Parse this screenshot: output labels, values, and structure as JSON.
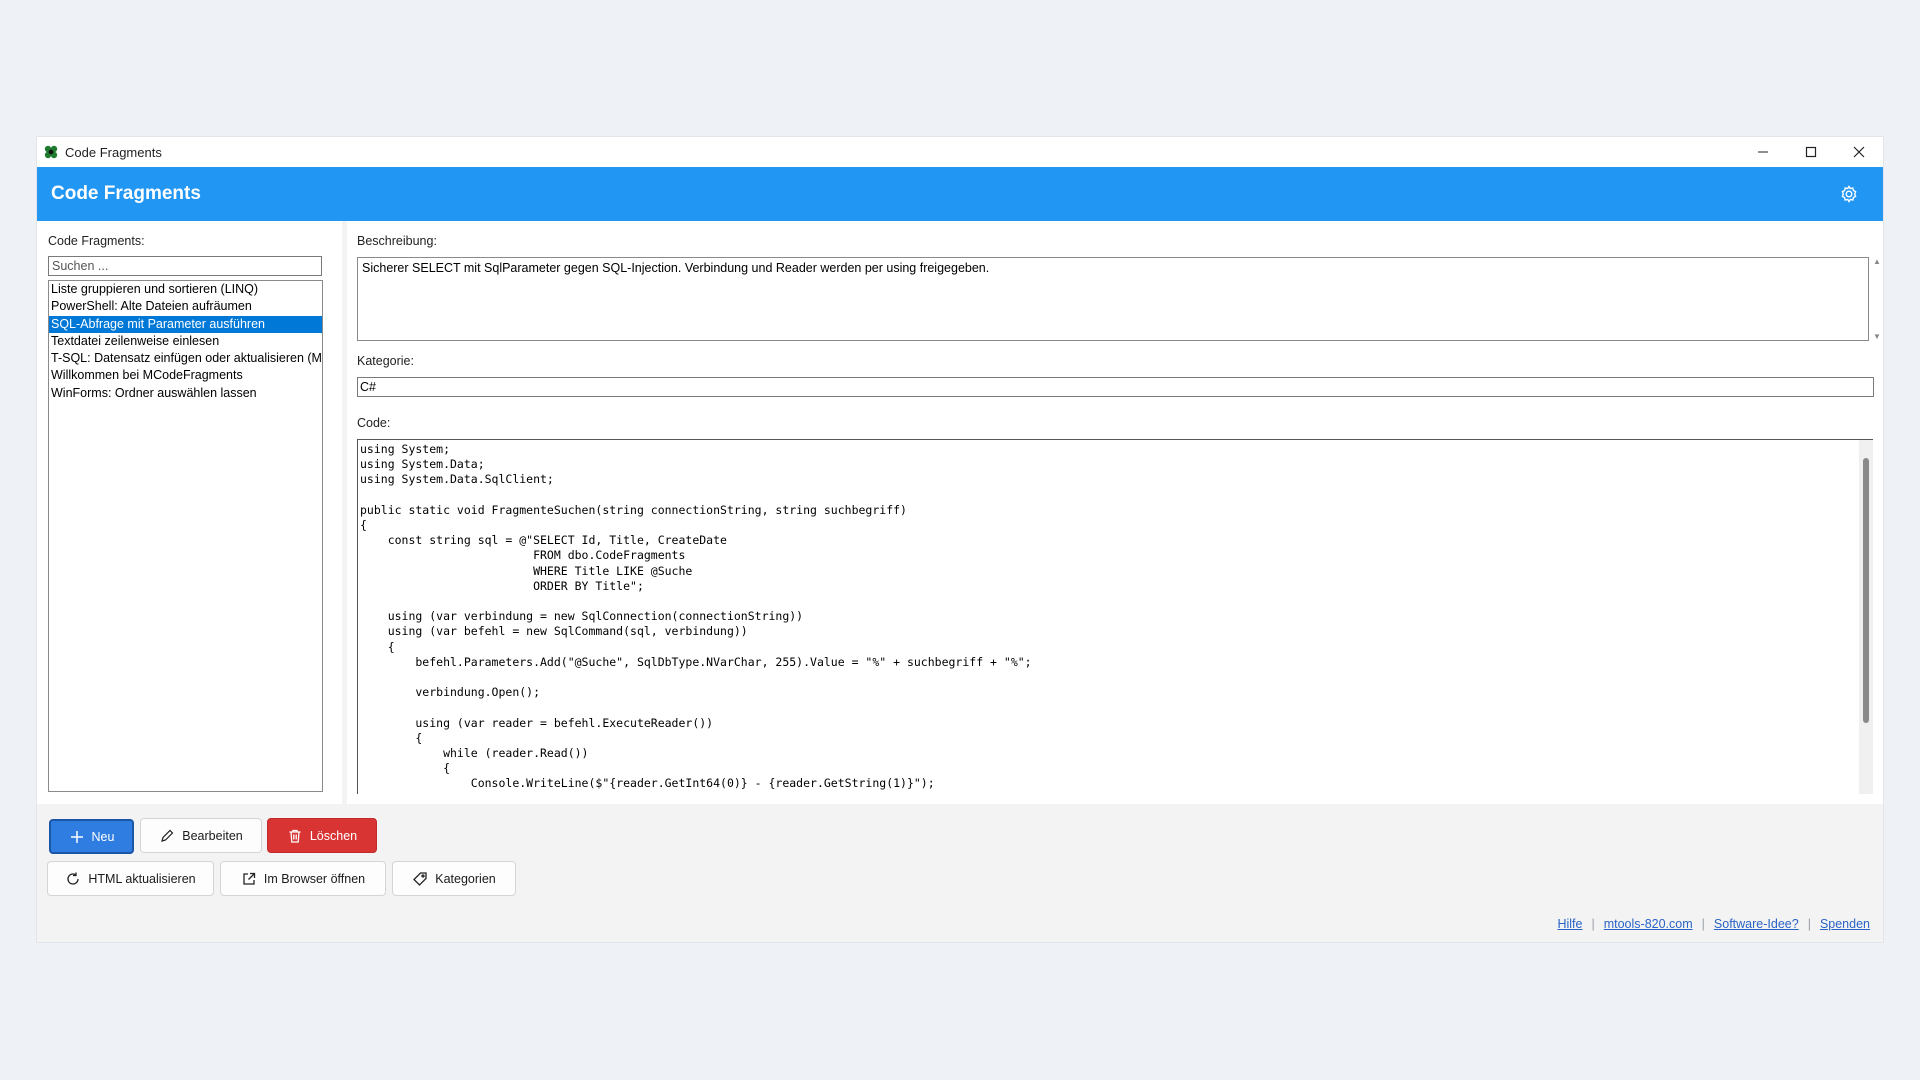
{
  "window": {
    "title": "Code Fragments",
    "controls": [
      "minimize-icon",
      "maximize-icon",
      "close-icon"
    ]
  },
  "header": {
    "title": "Code Fragments",
    "settings_icon": "gear-icon",
    "color": "#2196f3"
  },
  "sidebar": {
    "label": "Code Fragments:",
    "search_placeholder": "Suchen ...",
    "items": [
      "Liste gruppieren und sortieren (LINQ)",
      "PowerShell: Alte Dateien aufräumen",
      "SQL-Abfrage mit Parameter ausführen",
      "Textdatei zeilenweise einlesen",
      "T-SQL: Datensatz einfügen oder aktualisieren (MERGE)",
      "Willkommen bei MCodeFragments",
      "WinForms: Ordner auswählen lassen"
    ],
    "selected_index": 2
  },
  "detail": {
    "description_label": "Beschreibung:",
    "description": "Sicherer SELECT mit SqlParameter gegen SQL-Injection. Verbindung und Reader werden per using freigegeben.",
    "category_label": "Kategorie:",
    "category": "C#",
    "code_label": "Code:",
    "code": "using System;\nusing System.Data;\nusing System.Data.SqlClient;\n\npublic static void FragmenteSuchen(string connectionString, string suchbegriff)\n{\n    const string sql = @\"SELECT Id, Title, CreateDate\n                         FROM dbo.CodeFragments\n                         WHERE Title LIKE @Suche\n                         ORDER BY Title\";\n\n    using (var verbindung = new SqlConnection(connectionString))\n    using (var befehl = new SqlCommand(sql, verbindung))\n    {\n        befehl.Parameters.Add(\"@Suche\", SqlDbType.NVarChar, 255).Value = \"%\" + suchbegriff + \"%\";\n\n        verbindung.Open();\n\n        using (var reader = befehl.ExecuteReader())\n        {\n            while (reader.Read())\n            {\n                Console.WriteLine($\"{reader.GetInt64(0)} - {reader.GetString(1)}\");"
  },
  "toolbar": {
    "new_label": "Neu",
    "edit_label": "Bearbeiten",
    "delete_label": "Löschen",
    "refresh_html_label": "HTML aktualisieren",
    "open_browser_label": "Im Browser öffnen",
    "categories_label": "Kategorien",
    "icons": [
      "plus-icon",
      "pencil-icon",
      "trash-icon",
      "refresh-icon",
      "external-link-icon",
      "tag-icon"
    ]
  },
  "footer": {
    "links": [
      "Hilfe",
      "mtools-820.com",
      "Software-Idee?",
      "Spenden"
    ],
    "separator": "|"
  }
}
